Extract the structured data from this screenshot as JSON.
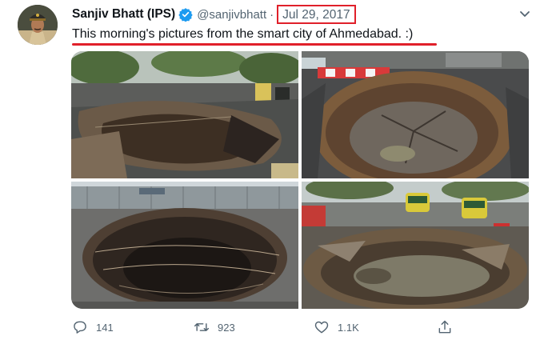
{
  "tweet": {
    "author_name": "Sanjiv Bhatt (IPS)",
    "handle": "@sanjivbhatt",
    "separator": "·",
    "date": "Jul 29, 2017",
    "text": "This morning's pictures from the smart city of Ahmedabad. :)",
    "verified_icon": "verified-badge-icon",
    "more_icon": "chevron-down-icon",
    "highlight_color": "#e0202a",
    "media": [
      {
        "name": "sinkhole-photo-1"
      },
      {
        "name": "sinkhole-photo-2"
      },
      {
        "name": "sinkhole-photo-3"
      },
      {
        "name": "sinkhole-photo-4"
      }
    ],
    "actions": {
      "reply_count": "141",
      "retweet_count": "923",
      "like_count": "1.1K",
      "reply_icon": "reply-icon",
      "retweet_icon": "retweet-icon",
      "like_icon": "heart-icon",
      "share_icon": "share-icon"
    }
  }
}
